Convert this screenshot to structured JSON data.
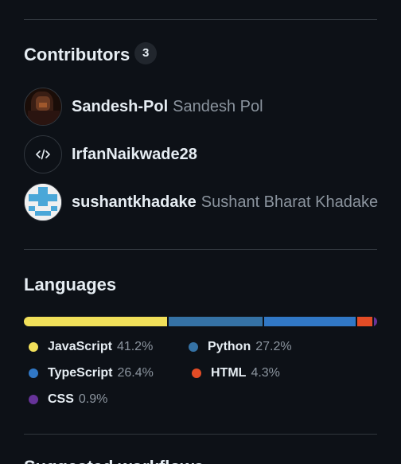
{
  "contributors": {
    "title": "Contributors",
    "count": "3",
    "items": [
      {
        "login": "Sandesh-Pol",
        "name": "Sandesh Pol"
      },
      {
        "login": "IrfanNaikwade28",
        "name": ""
      },
      {
        "login": "sushantkhadake",
        "name": "Sushant Bharat Khadake"
      }
    ]
  },
  "languages": {
    "title": "Languages",
    "items": [
      {
        "name": "JavaScript",
        "percent": "41.2%",
        "value": 41.2,
        "color": "#f1e05a"
      },
      {
        "name": "Python",
        "percent": "27.2%",
        "value": 27.2,
        "color": "#3572A5"
      },
      {
        "name": "TypeScript",
        "percent": "26.4%",
        "value": 26.4,
        "color": "#3178c6"
      },
      {
        "name": "HTML",
        "percent": "4.3%",
        "value": 4.3,
        "color": "#e34c26"
      },
      {
        "name": "CSS",
        "percent": "0.9%",
        "value": 0.9,
        "color": "#663399"
      }
    ]
  },
  "next_section": {
    "title": "Suggested workflows"
  },
  "icons": {
    "contributor_2_avatar": "code-icon"
  }
}
